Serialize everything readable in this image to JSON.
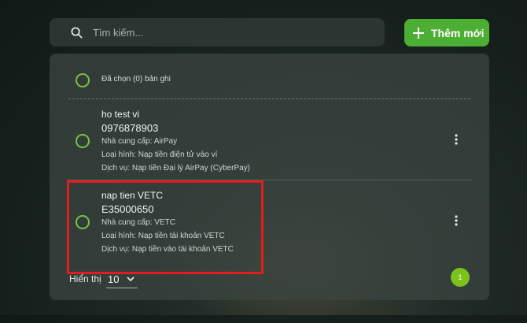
{
  "search": {
    "placeholder": "Tìm kiếm..."
  },
  "toolbar": {
    "add_label": "Thêm mới"
  },
  "selection": {
    "label": "Đã chọn (0) bản ghi"
  },
  "records": [
    {
      "name": "ho test vi",
      "code": "0976878903",
      "provider": "Nhà cung cấp: AirPay",
      "type": "Loại hình: Nạp tiền điện tử vào ví",
      "service": "Dịch vụ: Nạp tiền Đại lý AirPay (CyberPay)"
    },
    {
      "name": "nap tien VETC",
      "code": "E35000650",
      "provider": "Nhà cung cấp: VETC",
      "type": "Loại hình: Nạp tiền tài khoản VETC",
      "service": "Dịch vụ: Nạp tiền vào tài khoản VETC"
    }
  ],
  "pagination": {
    "page_size_label": "Hiển thị",
    "page_size_value": "10",
    "current_page": "1"
  },
  "colors": {
    "accent": "#4cae33",
    "radio": "#7bc043",
    "highlight": "#e31c1c",
    "page_button": "#7cc21d"
  }
}
